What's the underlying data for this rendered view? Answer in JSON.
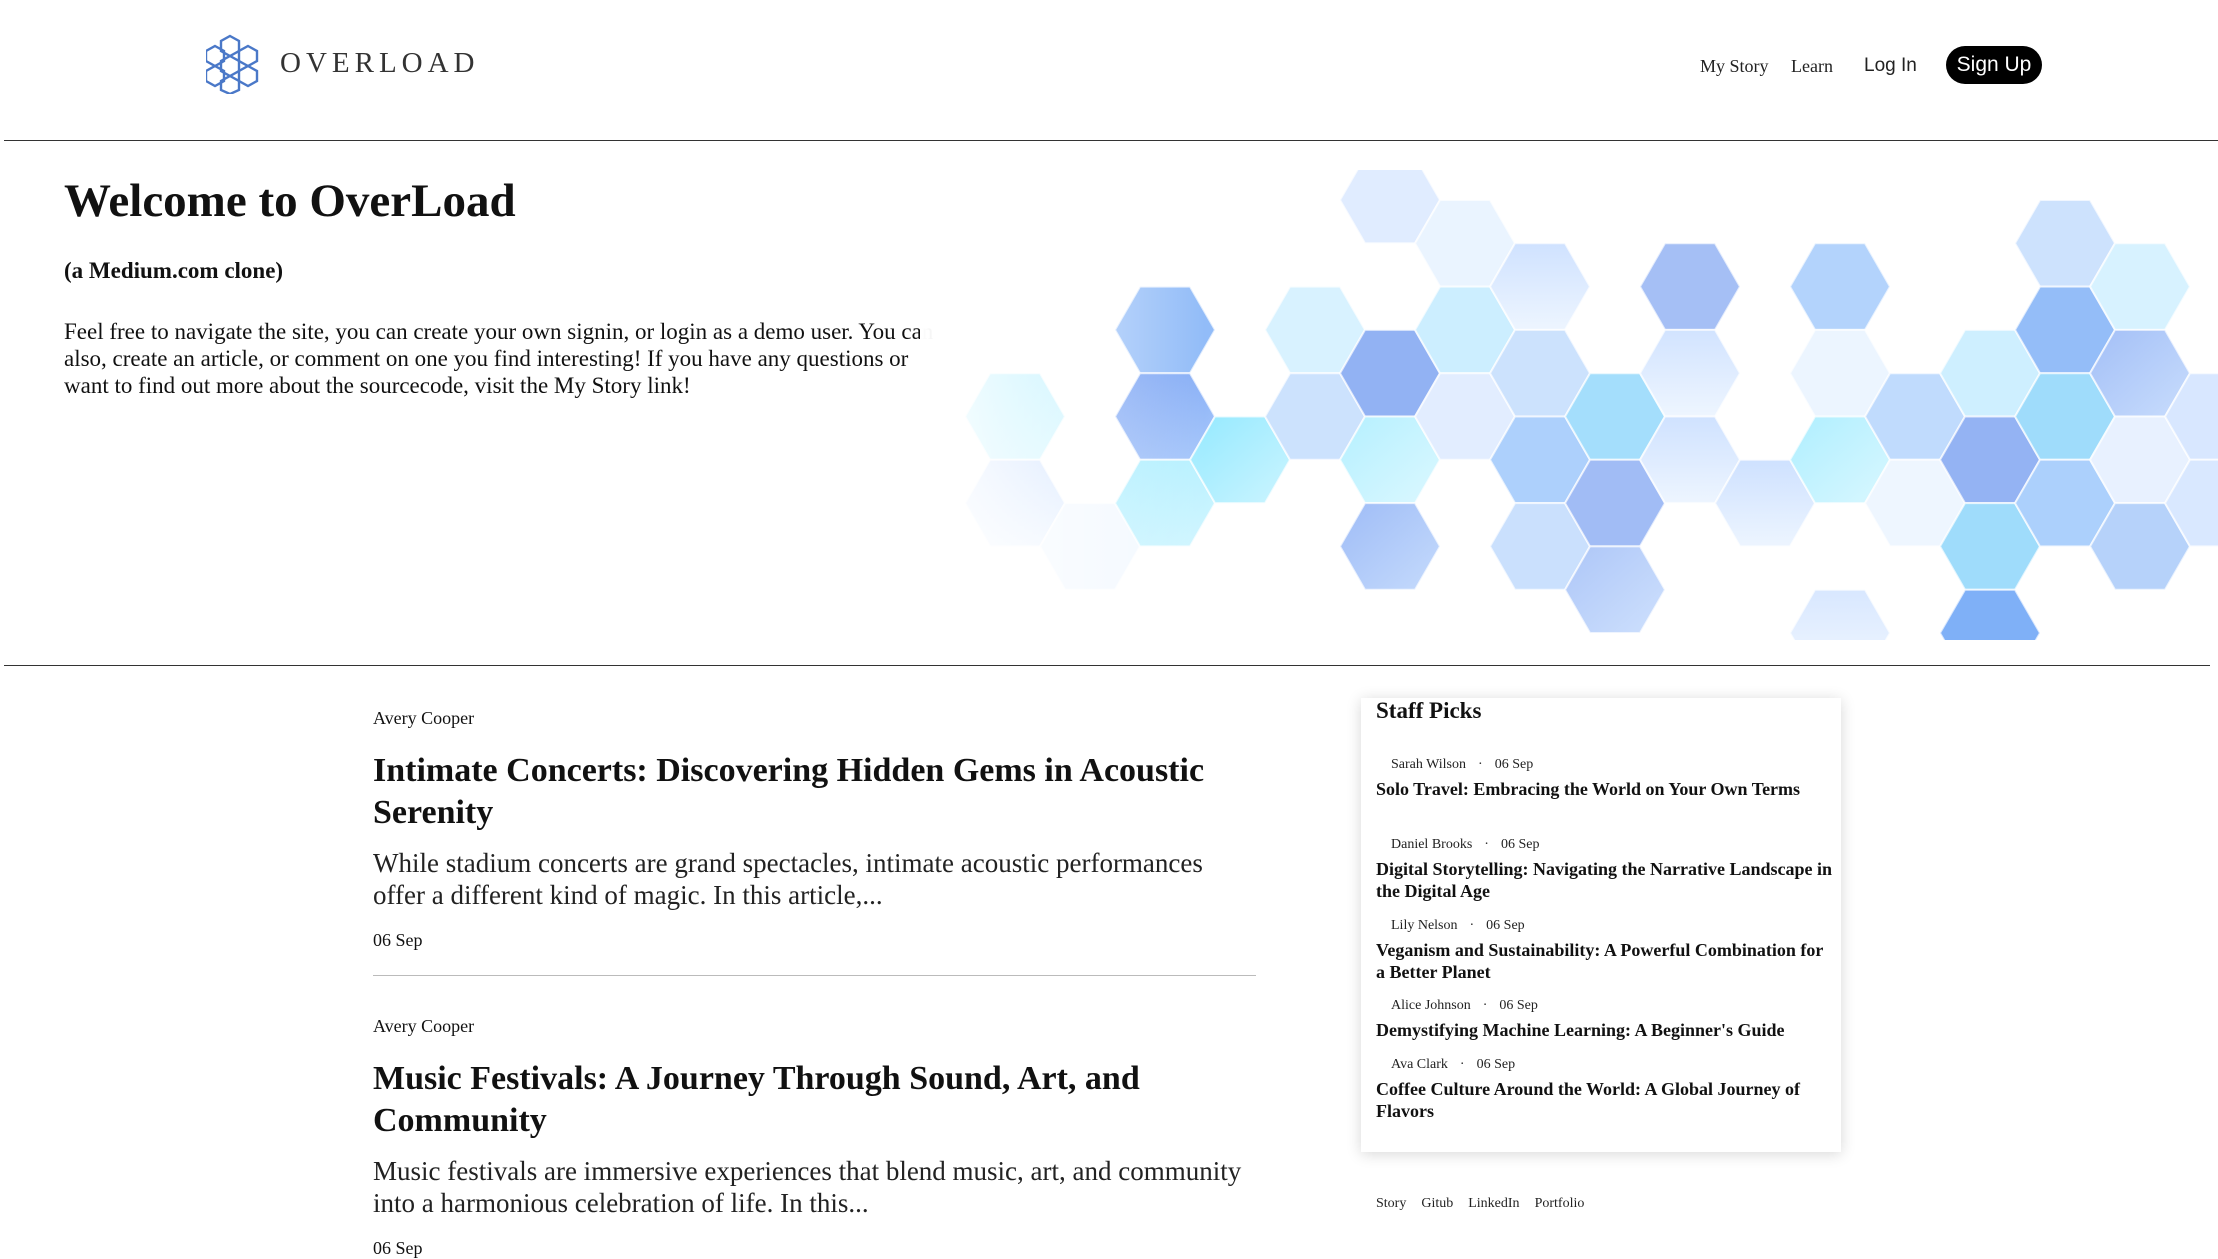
{
  "header": {
    "logo_text": "OVERLOAD",
    "nav": {
      "my_story": "My Story",
      "learn": "Learn",
      "login": "Log In",
      "signup": "Sign Up"
    }
  },
  "hero": {
    "title": "Welcome to OverLoad",
    "subtitle": "(a Medium.com clone)",
    "description": "Feel free to navigate the site, you can create your own signin, or login as a demo user. You can also, create an article, or comment on one you find interesting! If you have any questions or want to find out more about the sourcecode, visit the My Story link!"
  },
  "articles": [
    {
      "author": "Avery Cooper",
      "title": "Intimate Concerts: Discovering Hidden Gems in Acoustic Serenity",
      "excerpt": "While stadium concerts are grand spectacles, intimate acoustic performances offer a different kind of magic. In this article,...",
      "date": "06 Sep"
    },
    {
      "author": "Avery Cooper",
      "title": "Music Festivals: A Journey Through Sound, Art, and Community",
      "excerpt": "Music festivals are immersive experiences that blend music, art, and community into a harmonious celebration of life. In this...",
      "date": "06 Sep"
    }
  ],
  "staff_picks": {
    "heading": "Staff Picks",
    "items": [
      {
        "author": "Sarah Wilson",
        "date": "06 Sep",
        "title": "Solo Travel: Embracing the World on Your Own Terms"
      },
      {
        "author": "Daniel Brooks",
        "date": "06 Sep",
        "title": "Digital Storytelling: Navigating the Narrative Landscape in the Digital Age"
      },
      {
        "author": "Lily Nelson",
        "date": "06 Sep",
        "title": "Veganism and Sustainability: A Powerful Combination for a Better Planet"
      },
      {
        "author": "Alice Johnson",
        "date": "06 Sep",
        "title": "Demystifying Machine Learning: A Beginner's Guide"
      },
      {
        "author": "Ava Clark",
        "date": "06 Sep",
        "title": "Coffee Culture Around the World: A Global Journey of Flavors"
      }
    ],
    "separator": "·"
  },
  "footer": {
    "links": [
      "Story",
      "Gitub",
      "LinkedIn",
      "Portfolio"
    ]
  },
  "colors": {
    "signup_bg": "#000000",
    "hex_light": "#dbe9ff",
    "hex_mid": "#8fc4fb",
    "hex_deep": "#5f90f0",
    "hex_cyan": "#7ef0ff"
  }
}
